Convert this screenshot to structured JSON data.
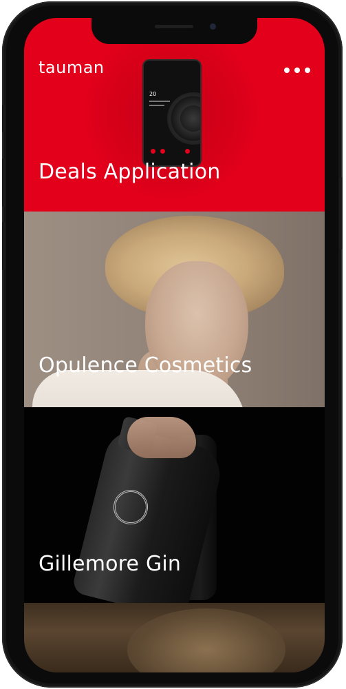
{
  "header": {
    "logo_text": "tauman",
    "menu_icon": "more-horizontal-icon"
  },
  "projects": [
    {
      "title": "Deals Application",
      "bg_color": "#e3001b"
    },
    {
      "title": "Opulence Cosmetics"
    },
    {
      "title": "Gillemore Gin",
      "bg_color": "#020202"
    }
  ],
  "deals_preview": {
    "screen_number": "20"
  },
  "colors": {
    "accent": "#e3001b",
    "device_frame": "#0b0b0b",
    "text": "#ffffff"
  }
}
